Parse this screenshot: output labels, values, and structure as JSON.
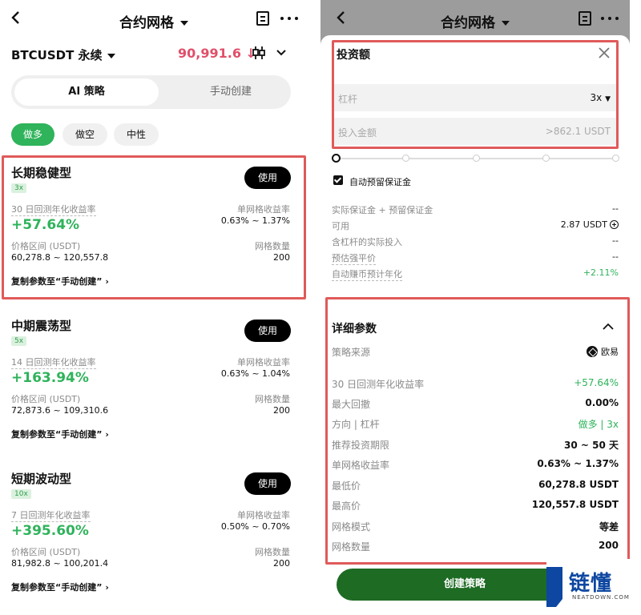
{
  "left": {
    "title": "合约网格",
    "pair": "BTCUSDT 永续",
    "price": "90,991.6 ↓",
    "tabs": {
      "ai": "AI 策略",
      "manual": "手动创建"
    },
    "filters": [
      "做多",
      "做空",
      "中性"
    ],
    "use_label": "使用",
    "copy_label": "复制参数至“手动创建”",
    "grid_rate_label": "单网格收益率",
    "price_range_label": "价格区间 (USDT)",
    "grid_count_label": "网格数量",
    "cards": [
      {
        "name": "长期稳健型",
        "lev": "3x",
        "apy_label": "30 日回测年化收益率",
        "apy": "+57.64%",
        "grid_rate": "0.63% ~ 1.37%",
        "range": "60,278.8 ~ 120,557.8",
        "count": "200"
      },
      {
        "name": "中期震荡型",
        "lev": "5x",
        "apy_label": "14 日回测年化收益率",
        "apy": "+163.94%",
        "grid_rate": "0.63% ~ 1.04%",
        "range": "72,873.6 ~ 109,310.6",
        "count": "200"
      },
      {
        "name": "短期波动型",
        "lev": "10x",
        "apy_label": "7 日回测年化收益率",
        "apy": "+395.60%",
        "grid_rate": "0.50% ~ 0.70%",
        "range": "81,982.8 ~ 100,201.4",
        "count": "200"
      }
    ]
  },
  "right": {
    "title": "合约网格",
    "invest_title": "投资额",
    "leverage_label": "杠杆",
    "leverage_value": "3x",
    "amount_placeholder": "投入金额",
    "amount_min": ">862.1 USDT",
    "auto_margin": "自动预留保证金",
    "info": [
      {
        "k": "实际保证金 + 预留保证金",
        "v": "--"
      },
      {
        "k": "可用",
        "v": "2.87 USDT"
      },
      {
        "k": "含杠杆的实际投入",
        "v": "--"
      },
      {
        "k": "预估强平价",
        "v": "--"
      },
      {
        "k": "自动赚币预计年化",
        "v": "+2.11%"
      }
    ],
    "detail_title": "详细参数",
    "details": [
      {
        "k": "策略来源",
        "v": "欧易"
      },
      {
        "k": "30 日回测年化收益率",
        "v": "+57.64%"
      },
      {
        "k": "最大回撤",
        "v": "0.00%"
      },
      {
        "k": "方向 | 杠杆",
        "v": "做多 | 3x"
      },
      {
        "k": "推荐投资期限",
        "v": "30 ~ 50 天"
      },
      {
        "k": "单网格收益率",
        "v": "0.63% ~ 1.37%"
      },
      {
        "k": "最低价",
        "v": "60,278.8 USDT"
      },
      {
        "k": "最高价",
        "v": "120,557.8 USDT"
      },
      {
        "k": "网格模式",
        "v": "等差"
      },
      {
        "k": "网格数量",
        "v": "200"
      }
    ],
    "create_label": "创建策略"
  },
  "watermark": {
    "text": "链懂",
    "sub": "NEATDOWN.COM"
  },
  "colors": {
    "green": "#2fb35b",
    "red_price": "#e0506a",
    "highlight_box": "#e05a5a",
    "button_green": "#1e6b24"
  }
}
